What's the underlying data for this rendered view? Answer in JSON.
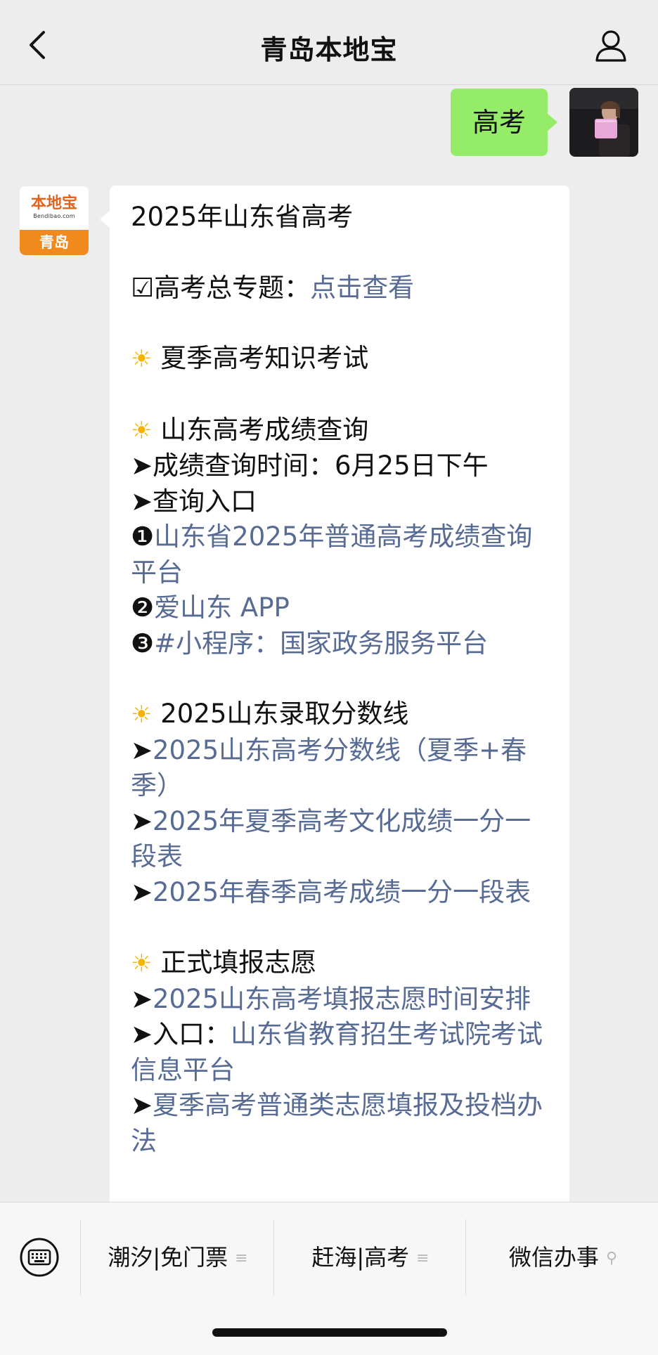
{
  "header": {
    "title": "青岛本地宝"
  },
  "outgoing": {
    "text": "高考"
  },
  "bot_avatar": {
    "logo_text": "本地宝",
    "logo_url": "Bendibao.com",
    "city": "青岛"
  },
  "message": {
    "title": "2025年山东省高考",
    "topic_prefix": "☑高考总专题：",
    "topic_link": "点击查看",
    "sec1": "夏季高考知识考试",
    "sec2": "山东高考成绩查询",
    "score_time": "➤成绩查询时间：6月25日下午",
    "entry_label": "➤查询入口",
    "entry1_num": "❶",
    "entry1": "山东省2025年普通高考成绩查询平台",
    "entry2_num": "❷",
    "entry2": "爱山东 APP",
    "entry3_num": "❸",
    "entry3": "#小程序：国家政务服务平台",
    "sec3": "2025山东录取分数线",
    "arrow": "➤",
    "link_a": "2025山东高考分数线（夏季+春季）",
    "link_b": "2025年夏季高考文化成绩一分一段表",
    "link_c": "2025年春季高考成绩一分一段表",
    "sec4": "正式填报志愿",
    "link_d": "2025山东高考填报志愿时间安排",
    "entry4_prefix": "➤入口：",
    "link_e": "山东省教育招生考试院考试信息平台",
    "link_f": "夏季高考普通类志愿填报及投档办法"
  },
  "bottom_menu": {
    "item1": "潮汐|免门票",
    "item2": "赶海|高考",
    "item3": "微信办事"
  }
}
